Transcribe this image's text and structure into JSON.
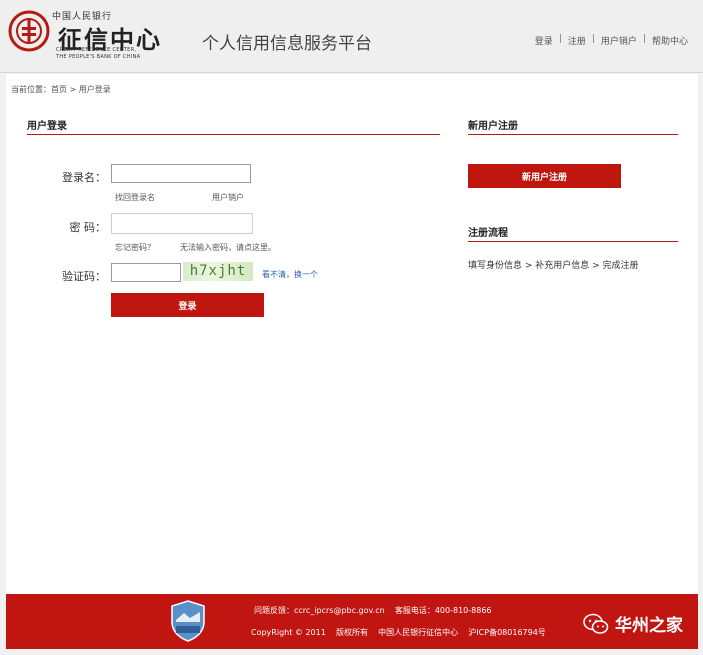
{
  "header": {
    "logo_top": "中国人民银行",
    "logo_main": "征信中心",
    "logo_en1": "CREDIT REFERENCE CENTER,",
    "logo_en2": "THE PEOPLE'S BANK OF CHINA",
    "platform_title": "个人信用信息服务平台",
    "nav": {
      "login": "登录",
      "register": "注册",
      "cancel": "用户销户",
      "help": "帮助中心",
      "sep": "|"
    }
  },
  "breadcrumb": "当前位置：首页 > 用户登录",
  "login": {
    "title": "用户登录",
    "username_label": "登录名：",
    "find_username": "找回登录名",
    "cancel_account": "用户销户",
    "password_label": "密  码：",
    "forgot_password": "忘记密码？",
    "cannot_input": "无法输入密码，请点这里。",
    "captcha_label": "验证码：",
    "captcha_text": "h7xjht",
    "refresh": "看不清，换一个",
    "submit": "登录"
  },
  "register": {
    "title": "新用户注册",
    "button": "新用户注册",
    "flow_title": "注册流程",
    "flow_text": "填写身份信息 > 补充用户信息 > 完成注册"
  },
  "footer": {
    "line1": "问题反馈：ccrc_ipcrs@pbc.gov.cn    客服电话：400-810-8866",
    "line2": "CopyRight © 2011    版权所有    中国人民银行征信中心    沪ICP备08016794号",
    "wechat": "华州之家"
  },
  "colors": {
    "accent": "#bf1710",
    "footer": "#c01510",
    "link": "#2a5db0"
  }
}
